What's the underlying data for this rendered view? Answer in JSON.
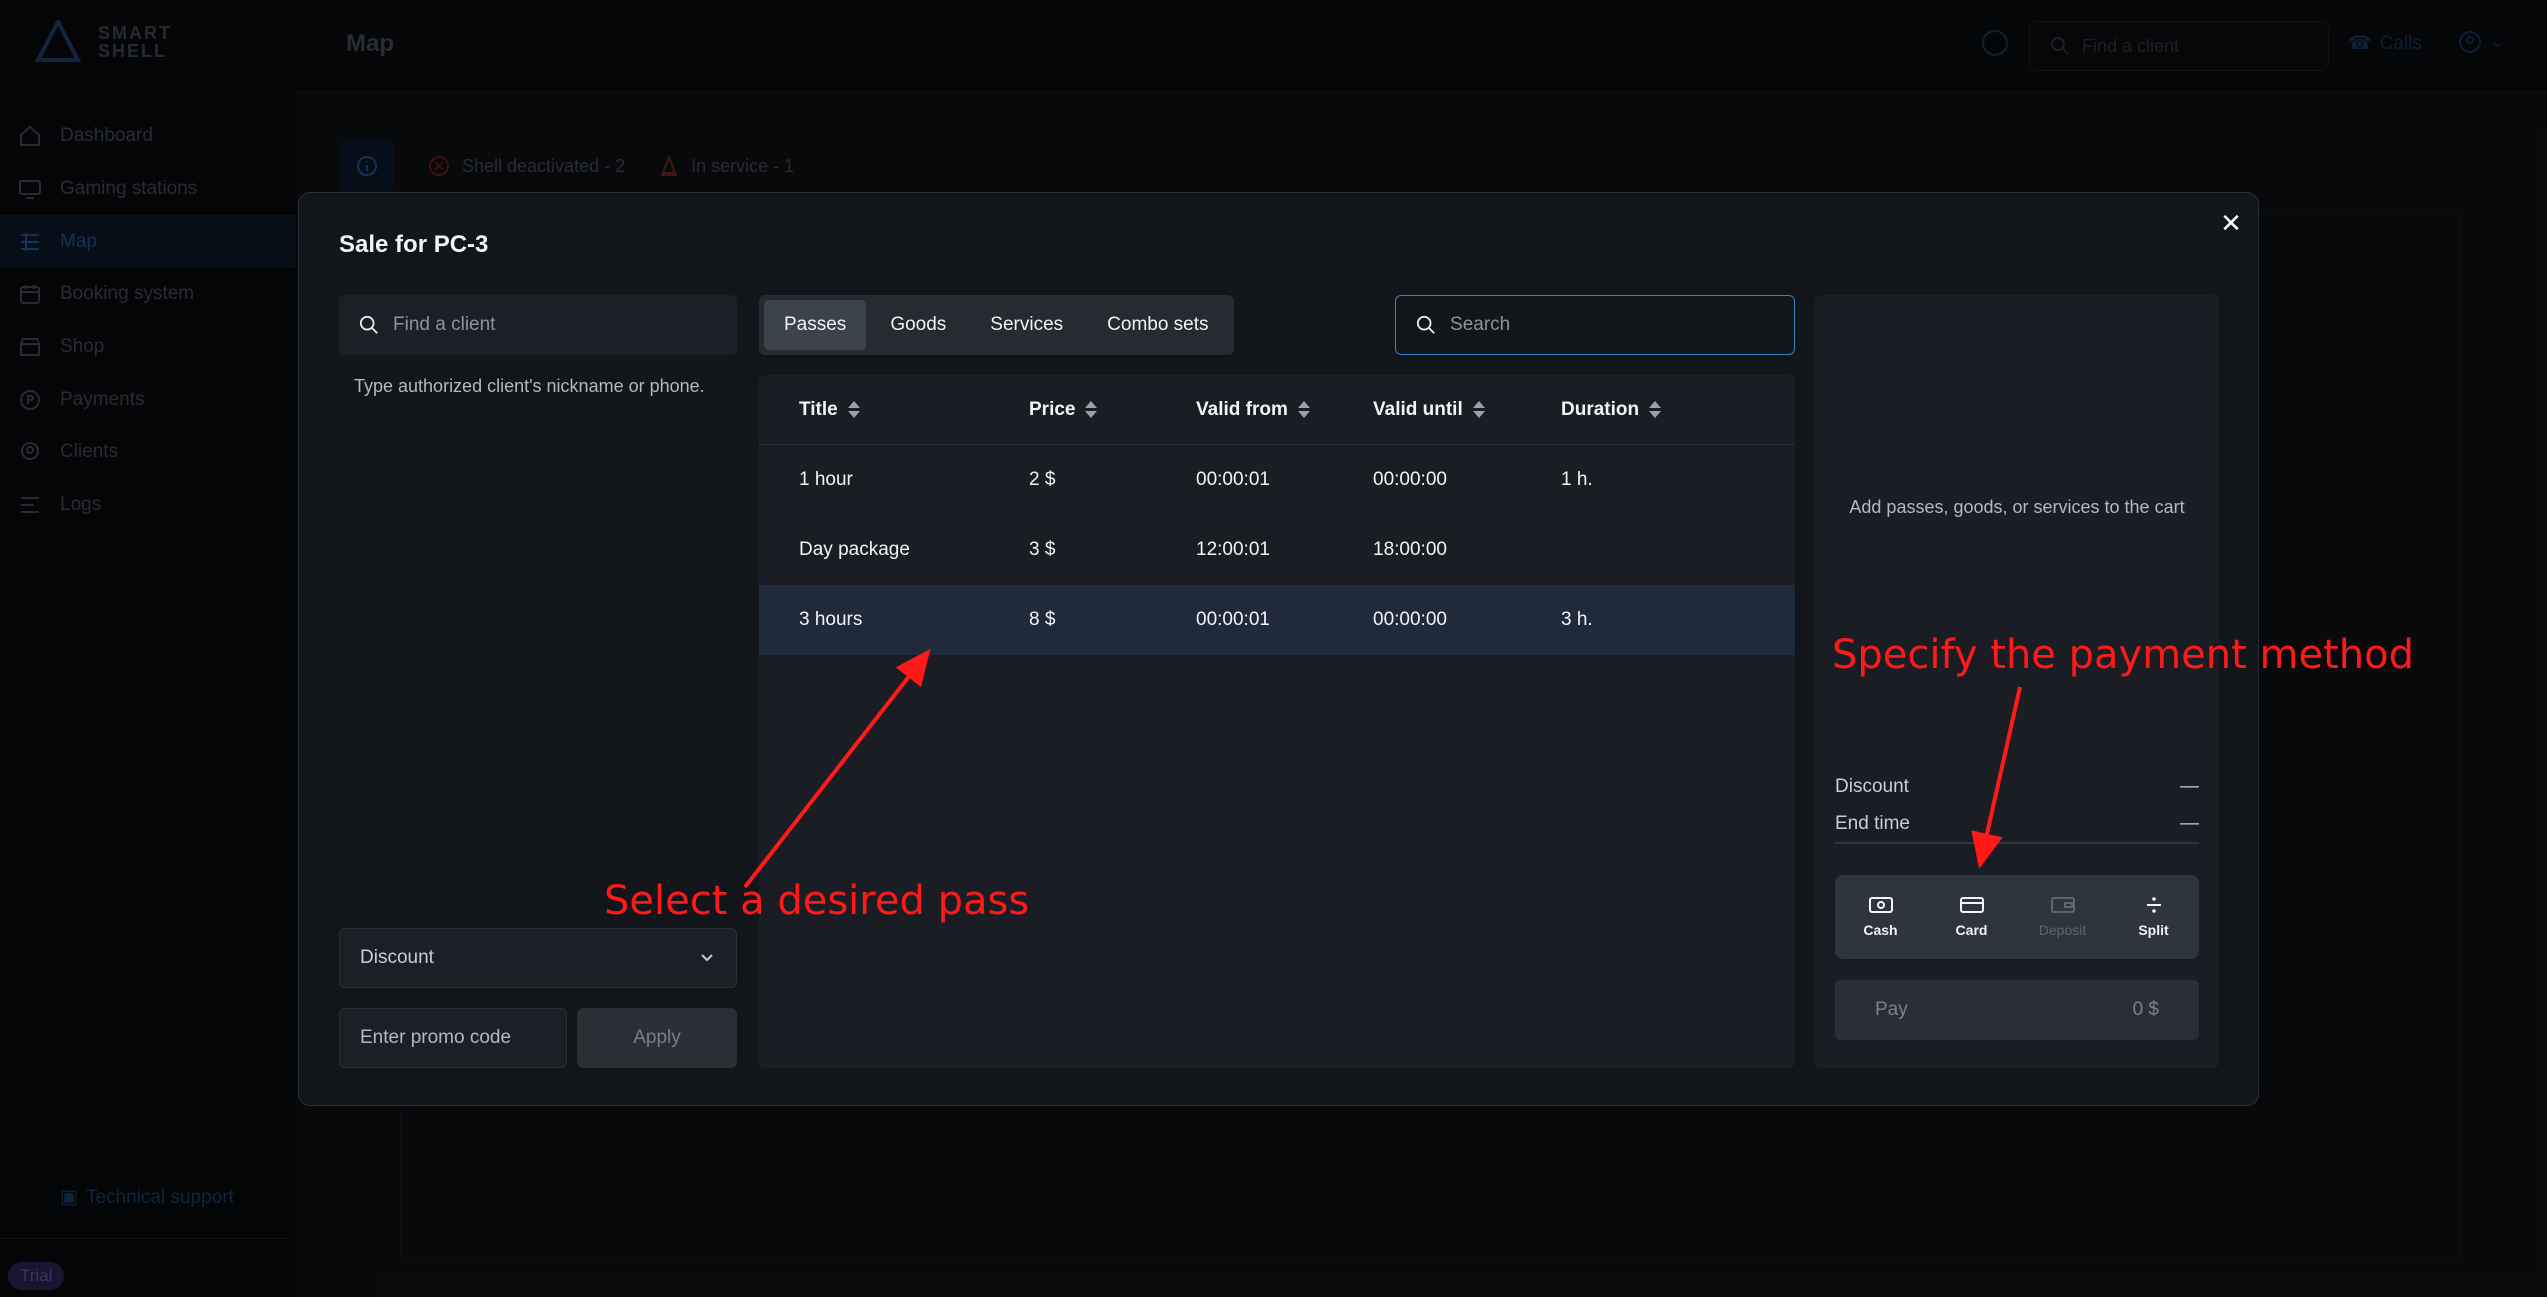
{
  "app": {
    "logo_text": [
      "SMART",
      "SHELL"
    ],
    "page_title": "Map",
    "search_placeholder": "Find a client",
    "calls_label": "Calls",
    "nav": [
      {
        "label": "Dashboard",
        "icon": "home-icon"
      },
      {
        "label": "Gaming stations",
        "icon": "monitor-icon"
      },
      {
        "label": "Map",
        "icon": "grid-icon",
        "active": true
      },
      {
        "label": "Booking system",
        "icon": "calendar-icon"
      },
      {
        "label": "Shop",
        "icon": "store-icon"
      },
      {
        "label": "Payments",
        "icon": "payment-icon"
      },
      {
        "label": "Clients",
        "icon": "clients-icon"
      },
      {
        "label": "Logs",
        "icon": "logs-icon"
      }
    ],
    "support_label": "Technical support",
    "trial_label": "Trial",
    "status_tabs": {
      "deactivated": "Shell deactivated - 2",
      "in_service": "In service - 1"
    }
  },
  "modal": {
    "title": "Sale for PC-3",
    "client_search_placeholder": "Find a client",
    "client_hint": "Type authorized client's nickname or phone.",
    "discount_label": "Discount",
    "promo_placeholder": "Enter promo code",
    "apply_label": "Apply",
    "tabs": [
      "Passes",
      "Goods",
      "Services",
      "Combo sets"
    ],
    "active_tab": "Passes",
    "search_placeholder": "Search",
    "table": {
      "columns": [
        "Title",
        "Price",
        "Valid from",
        "Valid until",
        "Duration"
      ],
      "rows": [
        {
          "title": "1 hour",
          "price": "2 $",
          "valid_from": "00:00:01",
          "valid_until": "00:00:00",
          "duration": "1 h."
        },
        {
          "title": "Day package",
          "price": "3 $",
          "valid_from": "12:00:01",
          "valid_until": "18:00:00",
          "duration": ""
        },
        {
          "title": "3 hours",
          "price": "8 $",
          "valid_from": "00:00:01",
          "valid_until": "00:00:00",
          "duration": "3 h.",
          "selected": true
        }
      ]
    },
    "cart": {
      "empty_text": "Add passes, goods, or services to the cart",
      "discount_label": "Discount",
      "discount_value": "—",
      "end_time_label": "End time",
      "end_time_value": "—",
      "payment_methods": [
        {
          "label": "Cash",
          "icon": "cash-icon",
          "enabled": true
        },
        {
          "label": "Card",
          "icon": "card-icon",
          "enabled": true
        },
        {
          "label": "Deposit",
          "icon": "wallet-icon",
          "enabled": false
        },
        {
          "label": "Split",
          "icon": "divide-icon",
          "enabled": true
        }
      ],
      "pay_label": "Pay",
      "pay_amount": "0 $"
    }
  },
  "annotations": {
    "select_pass": "Select a desired pass",
    "payment_method": "Specify the payment method",
    "color": "#ff1a1a"
  }
}
